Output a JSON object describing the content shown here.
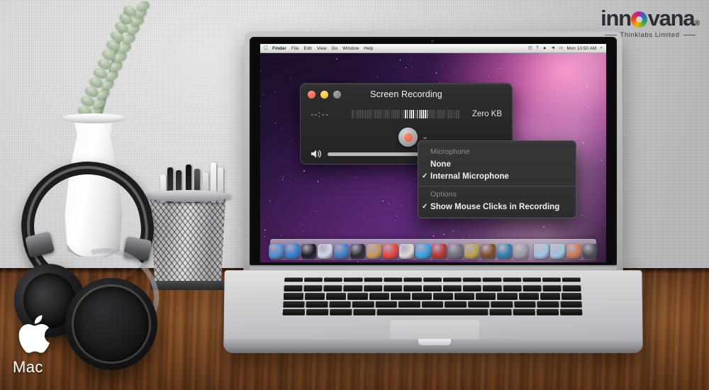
{
  "brand": {
    "name_prefix": "inn",
    "name_suffix": "vana",
    "registered": "®",
    "tagline": "Thinklabs Limited"
  },
  "os_badge": {
    "apple_icon": "apple-logo-icon",
    "label": "Mac"
  },
  "menubar": {
    "apple_icon": "",
    "items": [
      {
        "label": "Finder",
        "bold": true
      },
      {
        "label": "File",
        "bold": false
      },
      {
        "label": "Edit",
        "bold": false
      },
      {
        "label": "View",
        "bold": false
      },
      {
        "label": "Go",
        "bold": false
      },
      {
        "label": "Window",
        "bold": false
      },
      {
        "label": "Help",
        "bold": false
      }
    ],
    "status_icons": [
      "timemachine-icon",
      "bluetooth-icon",
      "wifi-icon",
      "volume-icon",
      "battery-icon"
    ],
    "status_glyphs": [
      "◴",
      "ᛡ",
      "▲",
      "◄",
      "▭"
    ],
    "clock": "Mon 10:50 AM",
    "search_icon": "⌕"
  },
  "window": {
    "title": "Screen Recording",
    "traffic_lights": [
      {
        "name": "close-button",
        "color": "#e8533f"
      },
      {
        "name": "minimize-button",
        "color": "#f0bc28"
      },
      {
        "name": "zoom-button",
        "color": "#77777b"
      }
    ],
    "elapsed_time": "--:--",
    "file_size": "Zero KB",
    "record_button": "record-button",
    "options_chevron": "⌄",
    "speaker_icon": "speaker-icon",
    "volume_value": 87
  },
  "dropdown": {
    "sections": [
      {
        "header": "Microphone",
        "items": [
          {
            "label": "None",
            "checked": false
          },
          {
            "label": "Internal Microphone",
            "checked": true
          }
        ]
      },
      {
        "header": "Options",
        "items": [
          {
            "label": "Show Mouse Clicks in Recording",
            "checked": true
          }
        ]
      }
    ],
    "check_glyph": "✓"
  },
  "dock": {
    "items": [
      {
        "name": "finder-icon",
        "color": "#4f8fd6"
      },
      {
        "name": "app-store-icon",
        "color": "#2f7fd0"
      },
      {
        "name": "dashboard-icon",
        "color": "#1c1c22"
      },
      {
        "name": "mail-icon",
        "color": "#cfd9e6"
      },
      {
        "name": "safari-icon",
        "color": "#3f7fc4"
      },
      {
        "name": "facetime-icon",
        "color": "#2b2b30"
      },
      {
        "name": "address-book-icon",
        "color": "#c89a5a"
      },
      {
        "name": "ical-icon",
        "color": "#e8453c"
      },
      {
        "name": "preview-icon",
        "color": "#dcdcd6"
      },
      {
        "name": "itunes-icon",
        "color": "#3aa3e0"
      },
      {
        "name": "iphoto-icon",
        "color": "#b8322a"
      },
      {
        "name": "imovie-icon",
        "color": "#6f6f78"
      },
      {
        "name": "iphoto-star-icon",
        "color": "#b8a24a"
      },
      {
        "name": "garageband-icon",
        "color": "#7a4c28"
      },
      {
        "name": "itunes-alt-icon",
        "color": "#2e7fae"
      },
      {
        "name": "system-preferences-icon",
        "color": "#9a9aa2"
      },
      {
        "name": "downloads-folder-icon",
        "color": "#9fc6e0"
      },
      {
        "name": "documents-folder-icon",
        "color": "#9fc6e0"
      },
      {
        "name": "magazines-icon",
        "color": "#c87a5a"
      },
      {
        "name": "trash-icon",
        "color": "#4a4a52"
      }
    ]
  }
}
